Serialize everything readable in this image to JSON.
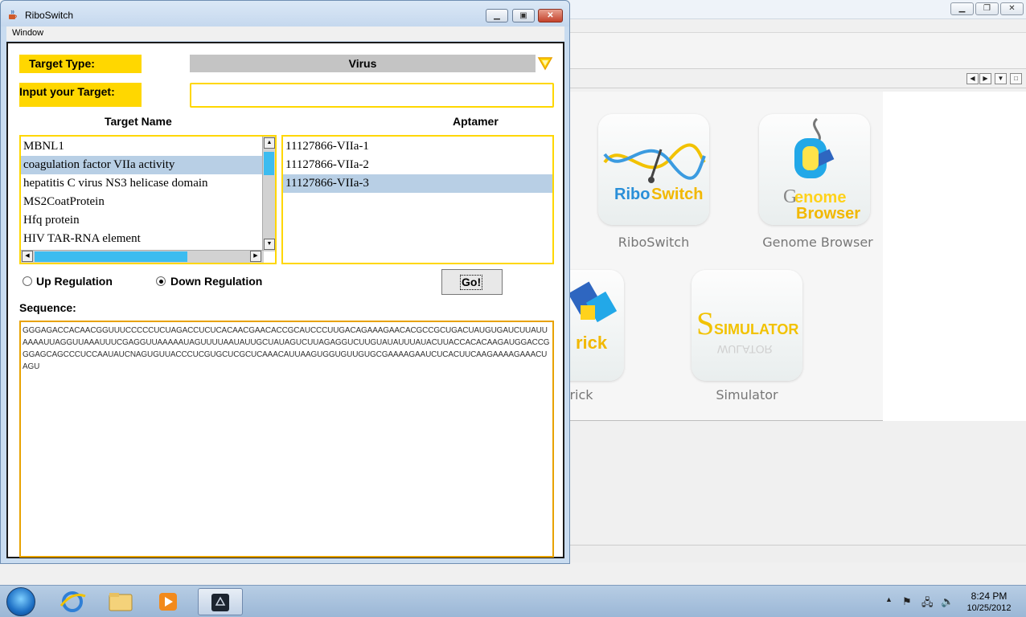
{
  "dialog": {
    "title": "RiboSwitch",
    "menu": [
      "Window"
    ],
    "target_type_label": "Target Type:",
    "target_type_value": "Virus",
    "input_target_label": "Input your Target:",
    "input_target_value": "",
    "target_name_header": "Target Name",
    "aptamer_header": "Aptamer",
    "target_names": [
      "MBNL1",
      "coagulation factor VIIa activity",
      "hepatitis C virus NS3 helicase domain",
      "MS2CoatProtein",
      "Hfq protein",
      "HIV TAR-RNA element"
    ],
    "selected_target_index": 1,
    "aptamers": [
      "11127866-VIIa-1",
      "11127866-VIIa-2",
      "11127866-VIIa-3"
    ],
    "selected_aptamer_index": 2,
    "radio_up_label": "Up Regulation",
    "radio_down_label": "Down Regulation",
    "selected_regulation": "down",
    "go_label": "Go!",
    "sequence_label": "Sequence:",
    "sequence": "GGGAGACCACAACGGUUUCCCCCUCUAGACCUCUCACAACGAACACCGCAUCCCUUGACAGAAAGAACACGCCGCUGACUAUGUGAUCUUAUUAAAAUUAGGUUAAAUUUCGAGGUUAAAAAUAGUUUUAAUAUUGCUAUAGUCUUAGAGGUCUUGUAUAUUUAUACUUACCACACAAGAUGGACCGGGAGCAGCCCUCCAAUAUCNAGUGUUACCCUCGUGCUCGCUCAAACAUUAAGUGGUGUUGUGCGAAAAGAAUCUCACUUCAAGAAAAGAAACUAGU"
  },
  "desktop": {
    "apps": [
      "RiboSwitch",
      "Genome Browser",
      "rick",
      "Simulator"
    ],
    "logo_text": {
      "riboswitch": "RiboSwitch",
      "genome_1": "Genome",
      "genome_2": "Browser",
      "rick": "rick",
      "simulator": "SIMULATOR"
    }
  },
  "taskbar": {
    "time": "8:24 PM",
    "date": "10/25/2012"
  },
  "colors": {
    "label_yellow": "#ffd700",
    "selection_blue": "#b8cfe5",
    "scroll_thumb": "#3cbcf0",
    "sequence_border": "#e8a200"
  }
}
